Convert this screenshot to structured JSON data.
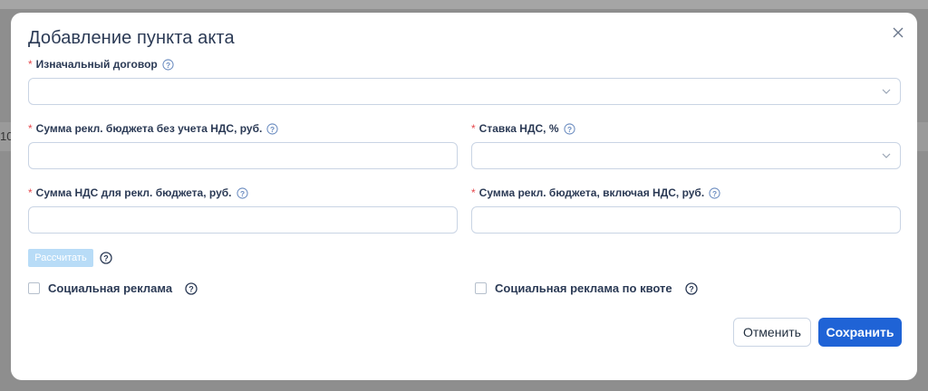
{
  "modal": {
    "title": "Добавление пункта акта",
    "fields": {
      "contract": {
        "label": "Изначальный договор",
        "value": ""
      },
      "budget_no_vat": {
        "label": "Сумма рекл. бюджета без учета НДС, руб.",
        "value": ""
      },
      "vat_rate": {
        "label": "Ставка НДС, %",
        "value": ""
      },
      "vat_amount": {
        "label": "Сумма НДС для рекл. бюджета, руб.",
        "value": ""
      },
      "budget_with_vat": {
        "label": "Сумма рекл. бюджета, включая НДС, руб.",
        "value": ""
      }
    },
    "calculate_label": "Рассчитать",
    "checkboxes": {
      "social": {
        "label": "Социальная реклама",
        "checked": false
      },
      "social_quota": {
        "label": "Социальная реклама по квоте",
        "checked": false
      }
    },
    "buttons": {
      "cancel": "Отменить",
      "save": "Сохранить"
    }
  },
  "background": {
    "partial_text": "10"
  },
  "colors": {
    "primary": "#1f63d6",
    "required": "#e5484d",
    "disabled_button": "#b8dcf7"
  }
}
